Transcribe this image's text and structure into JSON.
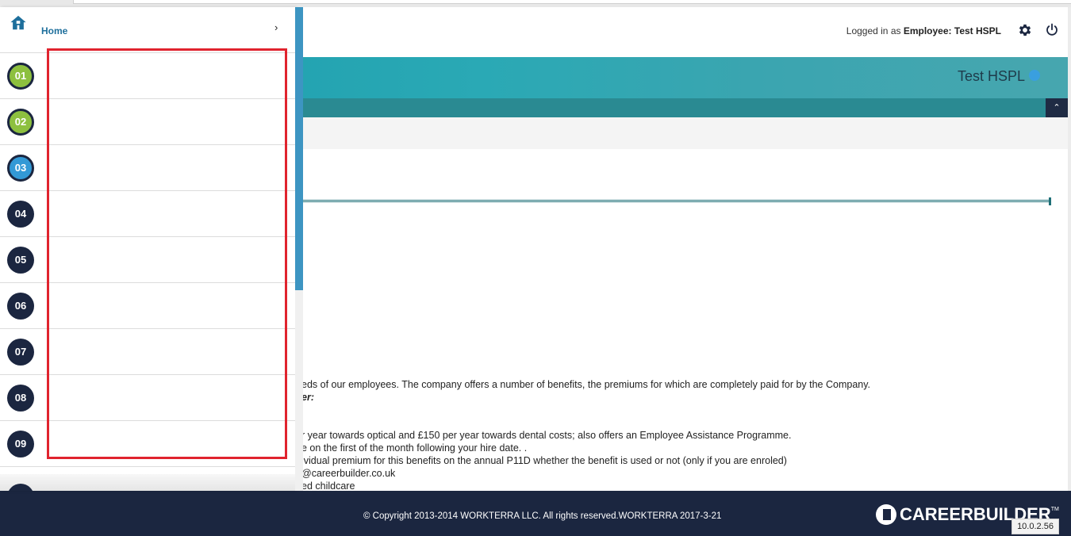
{
  "header": {
    "login_prefix": "Logged in as",
    "login_role": "Employee:",
    "login_user": "Test HSPL"
  },
  "banner": {
    "title": "Test HSPL"
  },
  "sidebar": {
    "home_label": "Home",
    "steps": [
      {
        "label": "01",
        "state": "done"
      },
      {
        "label": "02",
        "state": "done"
      },
      {
        "label": "03",
        "state": "current"
      },
      {
        "label": "04",
        "state": "todo"
      },
      {
        "label": "05",
        "state": "todo"
      },
      {
        "label": "06",
        "state": "todo"
      },
      {
        "label": "07",
        "state": "todo"
      },
      {
        "label": "08",
        "state": "todo"
      },
      {
        "label": "09",
        "state": "todo"
      }
    ]
  },
  "content": {
    "line1": "eds of our employees. The company offers a number of benefits, the premiums for which are completely paid for by the Company.",
    "line2": "er:",
    "line3": "r year towards optical and £150 per year towards dental costs; also offers an Employee Assistance Programme.",
    "line4": "e on the first of the month following your hire date. .",
    "line5": "ividual premium for this benefits on the annual P11D whether the benefit is used or not (only if you are enroled)",
    "line6": "@careerbuilder.co.uk",
    "line7": "ed childcare"
  },
  "footer": {
    "copyright": "© Copyright 2013-2014 WORKTERRA LLC. All rights reserved.WORKTERRA 2017-3-21",
    "logo_text": "CAREERBUILDER",
    "logo_tm": "TM",
    "version": "10.0.2.56"
  },
  "colors": {
    "accent_teal": "#2aa9b5",
    "navy": "#1b2640",
    "step_done": "#8dc03f",
    "step_current": "#3399d6",
    "highlight_red": "#e0232e"
  },
  "icons": [
    "home-icon",
    "chevron-right-icon",
    "gear-icon",
    "power-icon",
    "info-icon",
    "chevron-up-icon"
  ]
}
